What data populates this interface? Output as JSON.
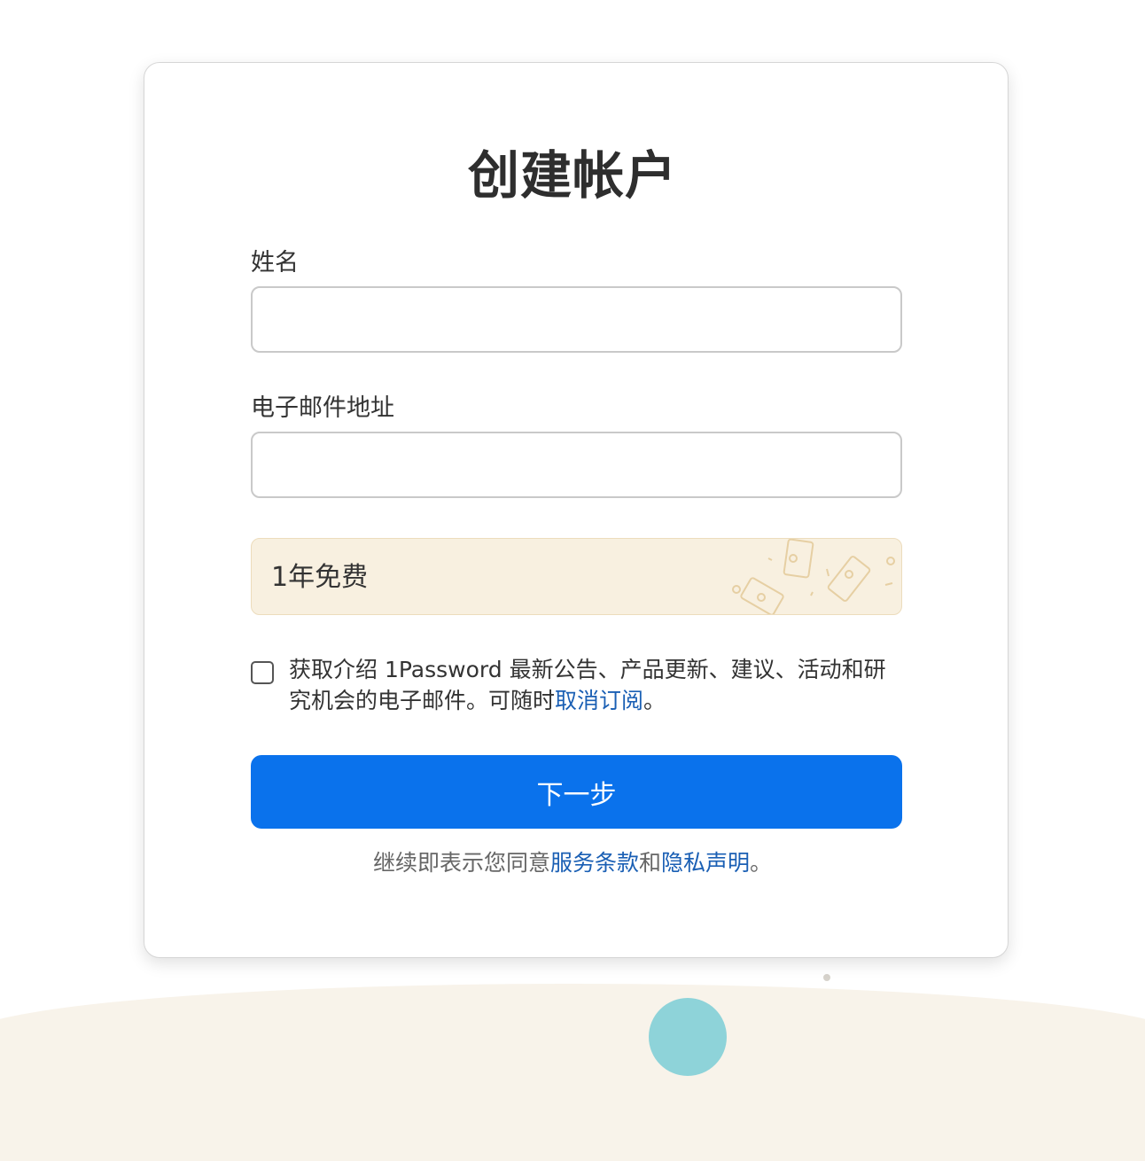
{
  "form": {
    "title": "创建帐户",
    "name_label": "姓名",
    "name_value": "",
    "email_label": "电子邮件地址",
    "email_value": ""
  },
  "promo": {
    "text": "1年免费"
  },
  "consent": {
    "checked": false,
    "text": "获取介绍 1Password 最新公告、产品更新、建议、活动和研究机会的电子邮件。可随时",
    "unsubscribe_link": "取消订阅",
    "suffix": "。"
  },
  "next_button": {
    "label": "下一步"
  },
  "terms": {
    "prefix": "继续即表示您同意",
    "tos_link": "服务条款",
    "and": "和",
    "privacy_link": "隐私声明",
    "suffix": "。"
  },
  "colors": {
    "primary_button": "#0a72ec",
    "link": "#1a5fb4",
    "promo_bg": "#f8f0e0"
  }
}
